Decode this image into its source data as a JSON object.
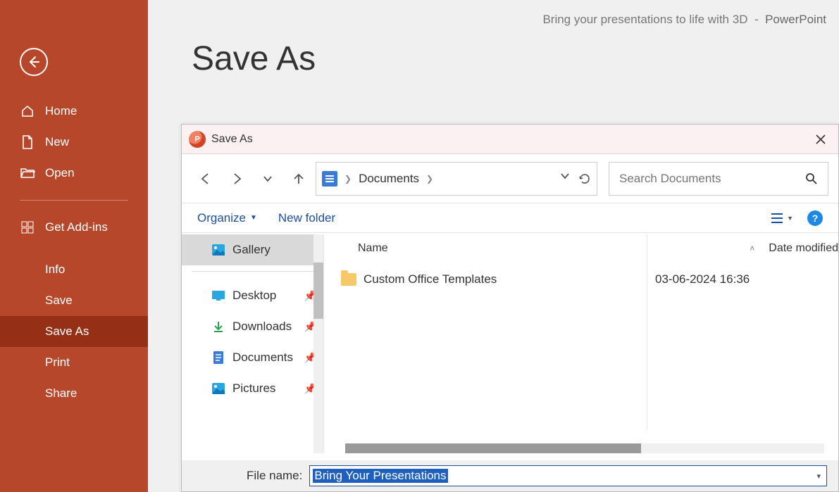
{
  "title_bar": {
    "doc": "Bring your presentations to life with 3D",
    "sep": "-",
    "app": "PowerPoint"
  },
  "page_title": "Save As",
  "nav": {
    "home": "Home",
    "new": "New",
    "open": "Open",
    "addins": "Get Add-ins",
    "info": "Info",
    "save": "Save",
    "saveas": "Save As",
    "print": "Print",
    "share": "Share"
  },
  "dialog": {
    "title": "Save As",
    "breadcrumb": "Documents",
    "search_placeholder": "Search Documents",
    "organize": "Organize",
    "newfolder": "New folder",
    "headers": {
      "name": "Name",
      "date": "Date modified"
    },
    "quick": {
      "gallery": "Gallery",
      "desktop": "Desktop",
      "downloads": "Downloads",
      "documents": "Documents",
      "pictures": "Pictures"
    },
    "rows": [
      {
        "name": "Custom Office Templates",
        "date": "03-06-2024 16:36"
      }
    ],
    "filename_label": "File name:",
    "filename_value": "Bring Your Presentations"
  }
}
